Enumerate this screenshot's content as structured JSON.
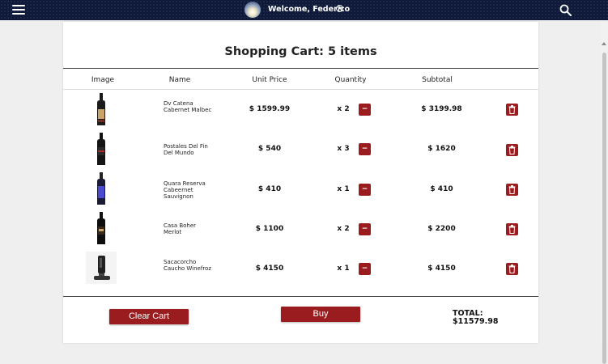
{
  "header": {
    "welcome_text": "Welcome, Federico"
  },
  "cart": {
    "title": "Shopping Cart: 5 items",
    "columns": {
      "image": "Image",
      "name": "Name",
      "unit_price": "Unit Price",
      "quantity": "Quantity",
      "subtotal": "Subtotal"
    },
    "items": [
      {
        "name": "Dv Catena Cabernet Malbec",
        "unit_price": "$ 1599.99",
        "quantity": "x 2",
        "subtotal": "$ 3199.98"
      },
      {
        "name": "Postales Del Fin Del Mundo",
        "unit_price": "$ 540",
        "quantity": "x 3",
        "subtotal": "$ 1620"
      },
      {
        "name": "Quara Reserva Cabeernet Sauvignon",
        "unit_price": "$ 410",
        "quantity": "x 1",
        "subtotal": "$ 410"
      },
      {
        "name": "Casa Boher Merlot",
        "unit_price": "$ 1100",
        "quantity": "x 2",
        "subtotal": "$ 2200"
      },
      {
        "name": "Sacacorcho Caucho Winefroz",
        "unit_price": "$ 4150",
        "quantity": "x 1",
        "subtotal": "$ 4150"
      }
    ],
    "minus_label": "−"
  },
  "footer": {
    "clear_label": "Clear Cart",
    "buy_label": "Buy",
    "total_label": "TOTAL:",
    "total_value": "$11579.98"
  },
  "colors": {
    "accent": "#9b1c1f",
    "topbar": "#0f1a3a"
  }
}
